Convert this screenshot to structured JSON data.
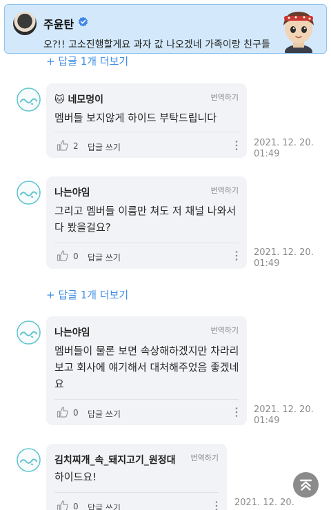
{
  "banner": {
    "name": "주윤탄",
    "text": "오?!! 고소진행할게요 과자 값 나오겠네 가족이랑 친구들끼리 갈등겠네 👍 잘가"
  },
  "more_replies_label": "+ 답글 1개 더보기",
  "translate_label": "번역하기",
  "reply_label": "답글 쓰기",
  "comments": [
    {
      "author": "🐱 네모멍이",
      "body": "멤버들 보지않게 하이드 부탁드립니다",
      "likes": "2",
      "date": "2021. 12. 20.",
      "time": "01:49"
    },
    {
      "author": "나는야임",
      "body": "그리고 멤버들 이름만 쳐도 저 채널 나와서 다 봤을걸요?",
      "likes": "0",
      "date": "2021. 12. 20.",
      "time": "01:49"
    },
    {
      "author": "나는야임",
      "body": "멤버들이 물론 보면 속상해하겠지만 차라리 보고 회사에 얘기해서 대처해주었음 좋겠네요",
      "likes": "0",
      "date": "2021. 12. 20.",
      "time": "01:49"
    },
    {
      "author": "김치찌개_속_돼지고기_원정대",
      "body": "하이드요!",
      "likes": "0",
      "date": "2021. 12. 20.",
      "time": ""
    }
  ],
  "colors": {
    "accent_blue": "#3f8ee6",
    "card_bg": "#f2f3f6",
    "banner_bg": "#d3e9fb",
    "avatar_teal": "#5fc4cd"
  },
  "icons": {
    "verified": "verified-badge-icon",
    "like": "thumbs-up-icon",
    "more": "kebab-menu-icon",
    "scroll_top": "scroll-to-top-icon"
  }
}
